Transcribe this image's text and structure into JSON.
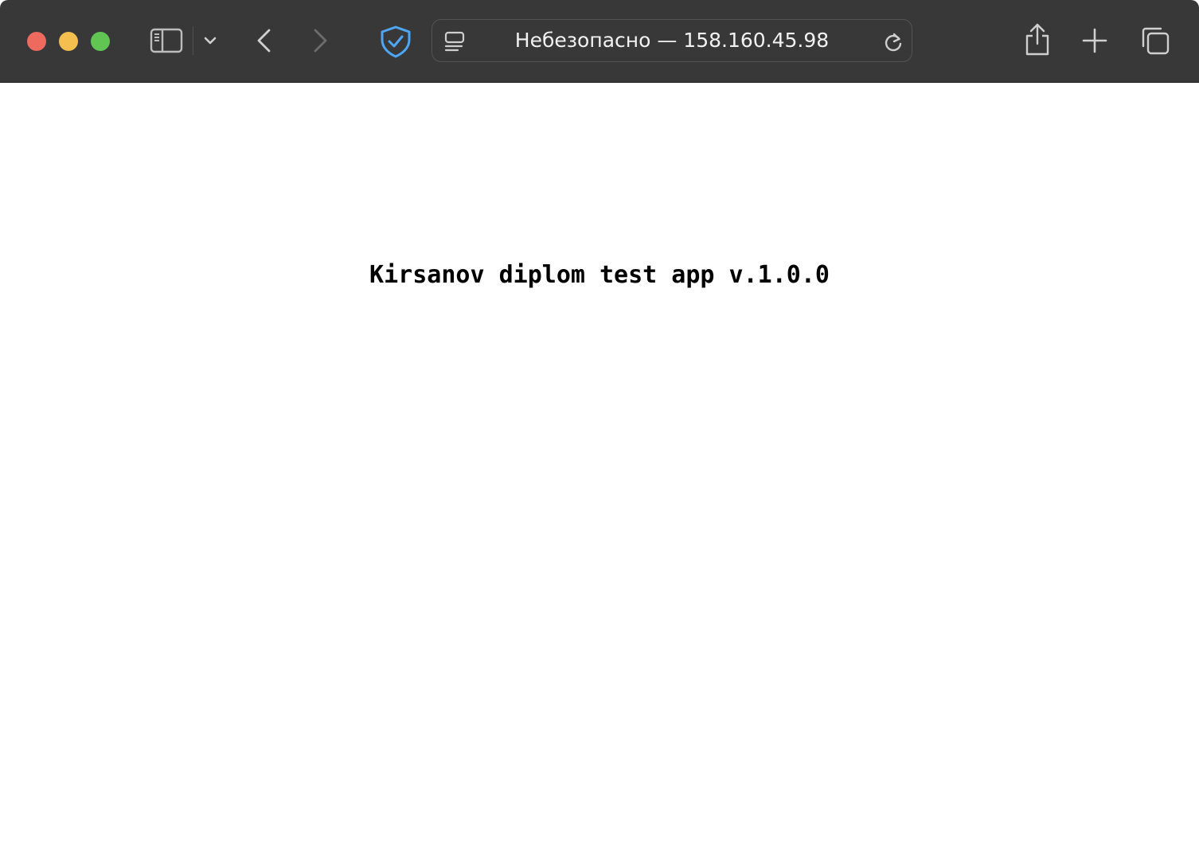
{
  "browser": {
    "window_controls": {
      "close_color": "#ee6a5f",
      "minimize_color": "#f5bf4f",
      "zoom_color": "#61c554"
    },
    "toolbar": {
      "background": "#383838",
      "icons": {
        "sidebar": "sidebar-icon",
        "tab_group_menu": "chevron-down-icon",
        "back": "chevron-left-icon",
        "forward": "chevron-right-icon",
        "privacy": "shield-check-icon",
        "share": "share-icon",
        "new_tab": "plus-icon",
        "tab_overview": "tab-overview-icon"
      },
      "privacy_shield_color": "#4ea6f5"
    },
    "address_bar": {
      "icon": "reader-page-icon",
      "text": "Небезопасно — 158.160.45.98",
      "reload_icon": "reload-icon"
    }
  },
  "page": {
    "heading": "Kirsanov diplom test app v.1.0.0",
    "background": "#ffffff"
  }
}
